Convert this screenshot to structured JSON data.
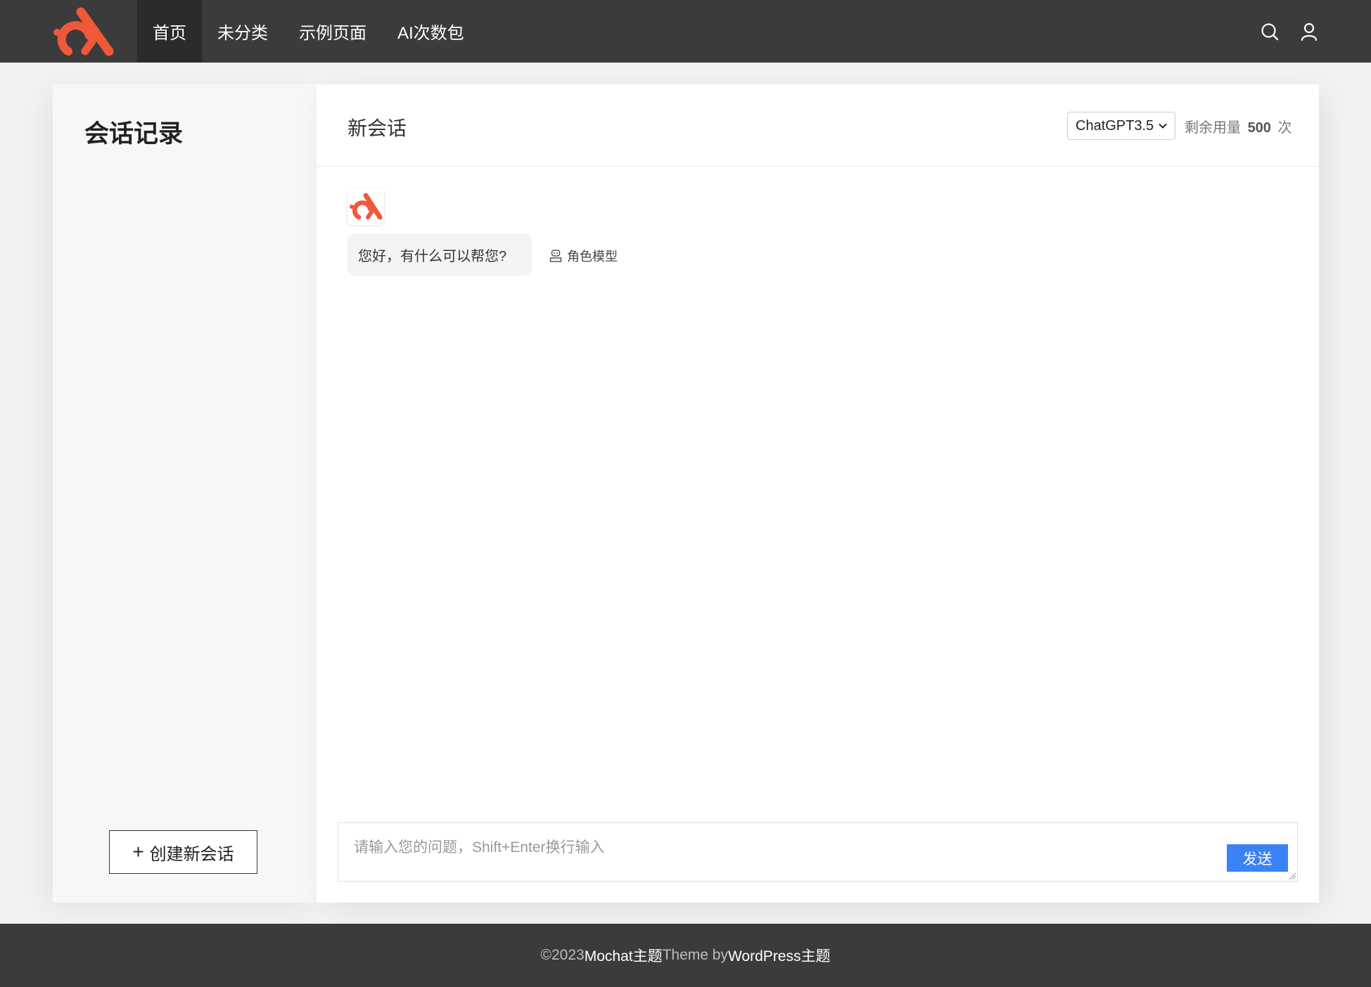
{
  "header": {
    "logo_icon": "brand-logo-icon",
    "nav": [
      {
        "label": "首页",
        "active": true
      },
      {
        "label": "未分类",
        "active": false
      },
      {
        "label": "示例页面",
        "active": false
      },
      {
        "label": "AI次数包",
        "active": false
      }
    ],
    "search_icon": "search-icon",
    "user_icon": "user-icon"
  },
  "sidebar": {
    "title": "会话记录",
    "new_chat_label": "创建新会话"
  },
  "chat": {
    "title": "新会话",
    "model_selected": "ChatGPT3.5",
    "quota_prefix": "剩余用量",
    "quota_value": "500",
    "quota_suffix": "次",
    "greeting": "您好，有什么可以帮您?",
    "role_model_label": "角色模型",
    "input_placeholder": "请输入您的问题，Shift+Enter换行输入",
    "send_label": "发送"
  },
  "footer": {
    "copyright": "©2023",
    "theme_name": "Mochat主题",
    "theme_by": "Theme by",
    "platform": "WordPress主题"
  },
  "colors": {
    "brand": "#f0583a",
    "header_bg": "#3b3b3b",
    "send_button": "#3b82f6"
  }
}
